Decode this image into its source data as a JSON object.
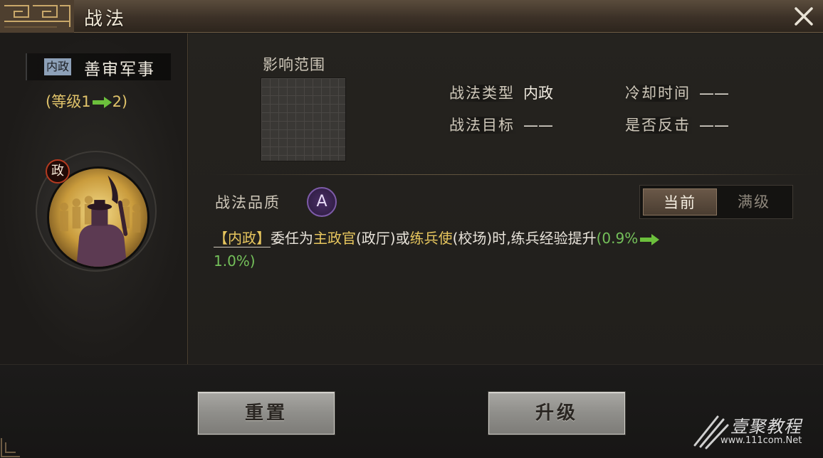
{
  "window": {
    "title": "战法",
    "close_icon": "close-icon"
  },
  "skill": {
    "type_tag": "内政",
    "name": "善审军事",
    "level_prefix": "(等级1",
    "level_suffix": "2)",
    "faction_badge": "政"
  },
  "details": {
    "range_label": "影响范围",
    "type_label": "战法类型",
    "type_value": "内政",
    "cooldown_label": "冷却时间",
    "cooldown_value": "——",
    "target_label": "战法目标",
    "target_value": "——",
    "counter_label": "是否反击",
    "counter_value": "——",
    "quality_label": "战法品质",
    "quality_value": "A"
  },
  "toggle": {
    "current_label": "当前",
    "max_label": "满级",
    "selected": "current"
  },
  "description": {
    "tag": "【内政】",
    "part1": "委任为",
    "hl1": "主政官",
    "part2": "(政厅)或",
    "hl2": "练兵使",
    "part3": "(校场)时,练兵经验提升",
    "val_from": "(0.9%",
    "val_to": "1.0%)"
  },
  "buttons": {
    "reset_label": "重置",
    "upgrade_label": "升级"
  },
  "watermark": {
    "text": "壹聚教程",
    "url": "www.111com.Net"
  },
  "colors": {
    "gold": "#e7c65e",
    "green": "#74c05a",
    "quality_purple": "#7d5ba8",
    "faction_red": "#b43a20"
  }
}
